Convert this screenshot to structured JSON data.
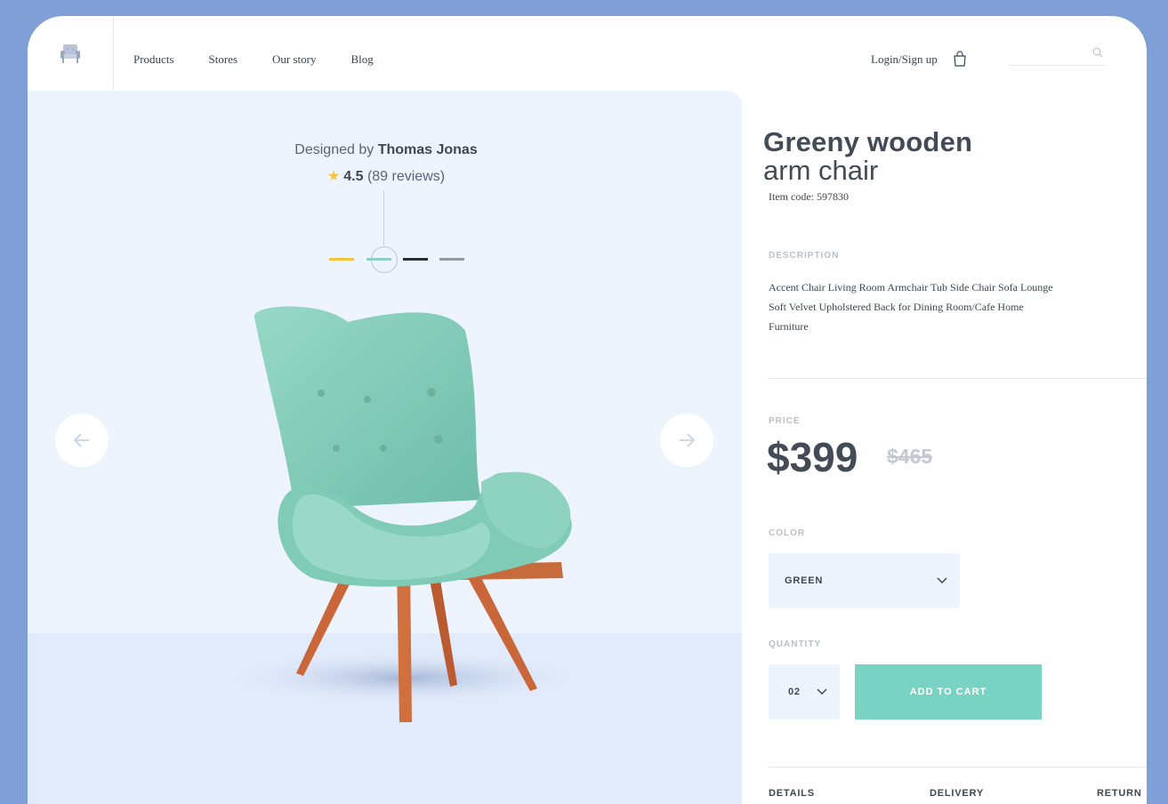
{
  "header": {
    "logo_icon": "armchair-icon",
    "nav": [
      "Products",
      "Stores",
      "Our story",
      "Blog"
    ],
    "login_label": "Login/Sign up",
    "cart_icon": "shopping-bag-icon",
    "search_placeholder": "",
    "search_icon": "search-icon"
  },
  "showcase": {
    "designed_prefix": "Designed by",
    "designer_name": "Thomas Jonas",
    "rating_value": "4.5",
    "rating_count": "(89 reviews)",
    "swatches": [
      {
        "name": "yellow",
        "color": "#f5c33b"
      },
      {
        "name": "green",
        "color": "#8fcfc0",
        "selected": true
      },
      {
        "name": "black",
        "color": "#2b2f36"
      },
      {
        "name": "grey",
        "color": "#949aa4"
      }
    ],
    "prev_icon": "arrow-left-icon",
    "next_icon": "arrow-right-icon",
    "chair_color": "#8fd1bf"
  },
  "product": {
    "title_line1": "Greeny wooden",
    "title_line2": "arm chair",
    "item_code": "Item code: 597830",
    "description_label": "DESCRIPTION",
    "description": "Accent Chair Living Room Armchair Tub Side Chair Sofa Lounge Soft Velvet Upholstered Back for Dining Room/Cafe Home Furniture",
    "price_label": "PRICE",
    "price": "$399",
    "old_price": "$465",
    "color_label": "COLOR",
    "color_value": "GREEN",
    "quantity_label": "QUANTITY",
    "quantity_value": "02",
    "add_to_cart": "ADD TO CART",
    "accent_color": "#78d3c3"
  },
  "tabs": [
    "DETAILS",
    "DELIVERY",
    "RETURN"
  ]
}
